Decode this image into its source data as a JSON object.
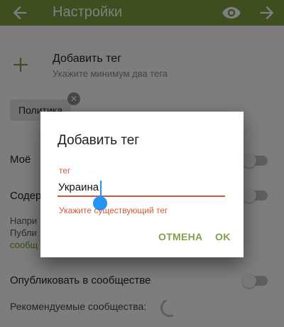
{
  "appbar": {
    "title": "Настройки",
    "color": "#7c9c3f",
    "icons": [
      "back-arrow-icon",
      "eye-icon",
      "forward-arrow-icon"
    ]
  },
  "add_tag_row": {
    "title": "Добавить тег",
    "subtitle": "Укажите минимум два тега",
    "icon": "plus-icon"
  },
  "tags": [
    "Политика"
  ],
  "settings": {
    "mine_label": "Моё",
    "content_label": "Содер",
    "hint_line1": "Напри",
    "hint_line2": "Публи",
    "hint_link": "сообщ",
    "publish_label": "Опубликовать в сообществе",
    "recommended_label": "Рекомендуемые сообщества:"
  },
  "dialog": {
    "title": "Добавить тег",
    "field_label": "тег",
    "field_value": "Украина",
    "error": "Укажите существующий тег",
    "cancel": "ОТМЕНА",
    "ok": "OK",
    "accent": "#d05a3a",
    "button_color": "#7ca24a"
  }
}
